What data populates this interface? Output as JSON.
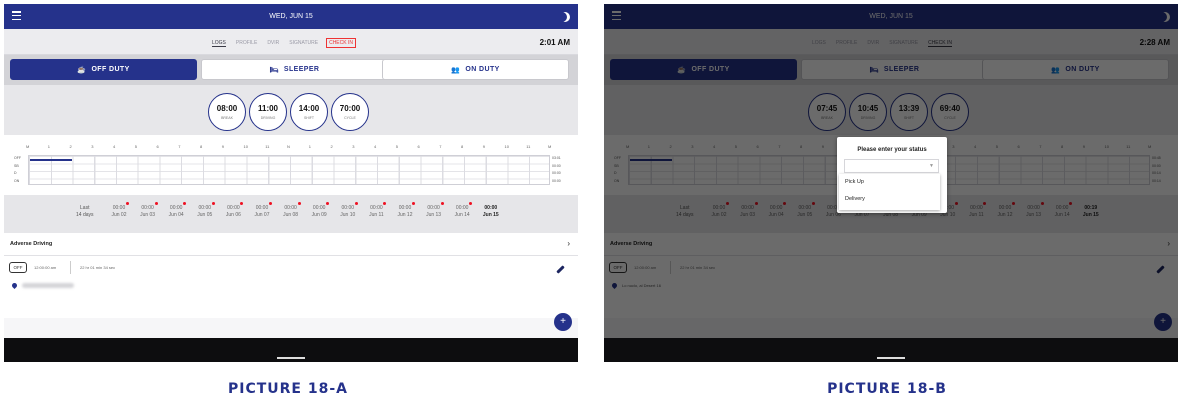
{
  "colors": {
    "primary": "#25328b",
    "highlight": "#e33333",
    "caption": "#25328b"
  },
  "captions": {
    "a": "PICTURE 18-A",
    "b": "PICTURE 18-B"
  },
  "grid": {
    "hour_labels": [
      "M",
      "1",
      "2",
      "3",
      "4",
      "5",
      "6",
      "7",
      "8",
      "9",
      "10",
      "11",
      "N",
      "1",
      "2",
      "3",
      "4",
      "5",
      "6",
      "7",
      "8",
      "9",
      "10",
      "11",
      "M"
    ],
    "row_labels": [
      "OFF",
      "SB",
      "D",
      "ON"
    ]
  },
  "screen_a": {
    "header": {
      "date": "WED, JUN 15",
      "menu_icon": "hamburger-menu-icon",
      "theme_icon": "moon-icon"
    },
    "tabs": [
      {
        "label": "LOGS"
      },
      {
        "label": "PROFILE"
      },
      {
        "label": "DVIR"
      },
      {
        "label": "SIGNATURE"
      },
      {
        "label": "CHECK IN"
      }
    ],
    "time": "2:01 AM",
    "status_buttons": [
      {
        "label": "OFF DUTY",
        "icon": "coffee-icon"
      },
      {
        "label": "SLEEPER",
        "icon": "bed-icon"
      },
      {
        "label": "ON DUTY",
        "icon": "worker-icon"
      }
    ],
    "clocks": [
      {
        "value": "08:00",
        "label": "BREAK"
      },
      {
        "value": "11:00",
        "label": "DRIVING"
      },
      {
        "value": "14:00",
        "label": "SHIFT"
      },
      {
        "value": "70:00",
        "label": "CYCLE"
      }
    ],
    "totals": [
      "03:01",
      "00:00",
      "00:00",
      "00:00"
    ],
    "last_label": "Last\n14 days",
    "days": [
      {
        "value": "00:00",
        "date": "Jun 02"
      },
      {
        "value": "00:00",
        "date": "Jun 03"
      },
      {
        "value": "00:00",
        "date": "Jun 04"
      },
      {
        "value": "00:00",
        "date": "Jun 05"
      },
      {
        "value": "00:00",
        "date": "Jun 06"
      },
      {
        "value": "00:00",
        "date": "Jun 07"
      },
      {
        "value": "00:00",
        "date": "Jun 08"
      },
      {
        "value": "00:00",
        "date": "Jun 09"
      },
      {
        "value": "00:00",
        "date": "Jun 10"
      },
      {
        "value": "00:00",
        "date": "Jun 11"
      },
      {
        "value": "00:00",
        "date": "Jun 12"
      },
      {
        "value": "00:00",
        "date": "Jun 13"
      },
      {
        "value": "00:00",
        "date": "Jun 14"
      },
      {
        "value": "00:00",
        "date": "Jun 15"
      }
    ],
    "adverse": "Adverse Driving",
    "entry": {
      "status": "OFF",
      "start": "12:00:00 am",
      "duration": "22 hr 01 min 34 sec"
    }
  },
  "screen_b": {
    "header": {
      "date": "WED, JUN 15"
    },
    "tabs": [
      {
        "label": "LOGS"
      },
      {
        "label": "PROFILE"
      },
      {
        "label": "DVIR"
      },
      {
        "label": "SIGNATURE"
      },
      {
        "label": "CHECK IN"
      }
    ],
    "time": "2:28 AM",
    "status_buttons": [
      {
        "label": "OFF DUTY",
        "icon": "coffee-icon"
      },
      {
        "label": "SLEEPER",
        "icon": "bed-icon"
      },
      {
        "label": "ON DUTY",
        "icon": "worker-icon"
      }
    ],
    "clocks": [
      {
        "value": "07:45",
        "label": "BREAK"
      },
      {
        "value": "10:45",
        "label": "DRIVING"
      },
      {
        "value": "13:39",
        "label": "SHIFT"
      },
      {
        "value": "69:40",
        "label": "CYCLE"
      }
    ],
    "totals": [
      "00:45",
      "00:00",
      "00:14",
      "00:14"
    ],
    "last_label": "Last\n14 days",
    "days": [
      {
        "value": "00:00",
        "date": "Jun 02"
      },
      {
        "value": "00:00",
        "date": "Jun 03"
      },
      {
        "value": "00:00",
        "date": "Jun 04"
      },
      {
        "value": "00:00",
        "date": "Jun 05"
      },
      {
        "value": "00:00",
        "date": "Jun 06"
      },
      {
        "value": "00:00",
        "date": "Jun 07"
      },
      {
        "value": "00:00",
        "date": "Jun 08"
      },
      {
        "value": "00:00",
        "date": "Jun 09"
      },
      {
        "value": "00:00",
        "date": "Jun 10"
      },
      {
        "value": "00:00",
        "date": "Jun 11"
      },
      {
        "value": "00:00",
        "date": "Jun 12"
      },
      {
        "value": "00:00",
        "date": "Jun 13"
      },
      {
        "value": "00:00",
        "date": "Jun 14"
      },
      {
        "value": "00:19",
        "date": "Jun 15"
      }
    ],
    "adverse": "Adverse Driving",
    "entry": {
      "status": "OFF",
      "start": "12:00:00 am",
      "duration": "22 hr 01 min 34 sec",
      "location": "Lo nuclo, al Desert 16"
    },
    "dialog": {
      "title": "Please enter your status",
      "options": [
        "Pick Up",
        "Delivery"
      ]
    }
  }
}
